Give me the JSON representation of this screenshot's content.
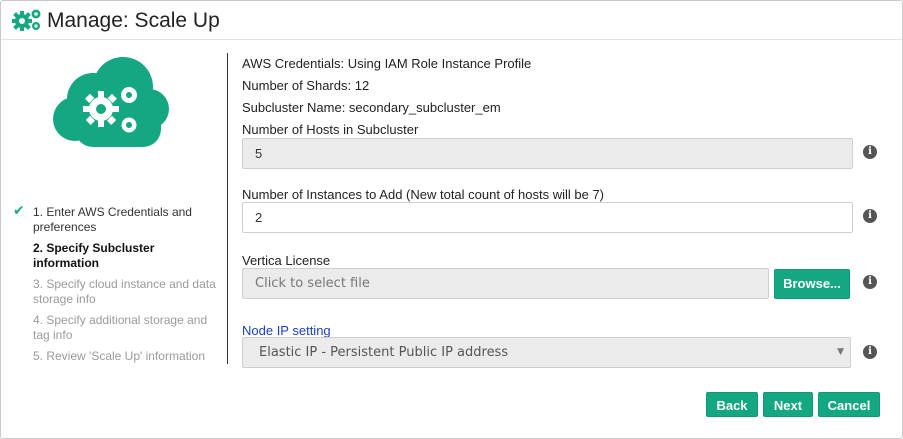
{
  "window": {
    "title": "Manage: Scale Up"
  },
  "steps": [
    {
      "label": "1. Enter AWS Credentials and preferences",
      "state": "done"
    },
    {
      "label": "2. Specify Subcluster information",
      "state": "active"
    },
    {
      "label": "3. Specify cloud instance and data storage info",
      "state": "pending"
    },
    {
      "label": "4. Specify additional storage and tag info",
      "state": "pending"
    },
    {
      "label": "5. Review 'Scale Up' information",
      "state": "pending"
    }
  ],
  "summary": {
    "aws_credentials": "AWS Credentials: Using IAM Role Instance Profile",
    "shards": "Number of Shards: 12",
    "subcluster_name": "Subcluster Name: secondary_subcluster_em"
  },
  "form": {
    "hosts_label": "Number of Hosts in Subcluster",
    "hosts_value": "5",
    "instances_label": "Number of Instances to Add (New total count of hosts will be 7)",
    "instances_value": "2",
    "license_label": "Vertica License",
    "license_placeholder": "Click to select file",
    "browse_label": "Browse...",
    "node_ip_label": "Node IP setting",
    "node_ip_value": "Elastic IP - Persistent Public IP address"
  },
  "buttons": {
    "back": "Back",
    "next": "Next",
    "cancel": "Cancel"
  },
  "colors": {
    "accent": "#14a782",
    "link": "#1a3fc1"
  }
}
